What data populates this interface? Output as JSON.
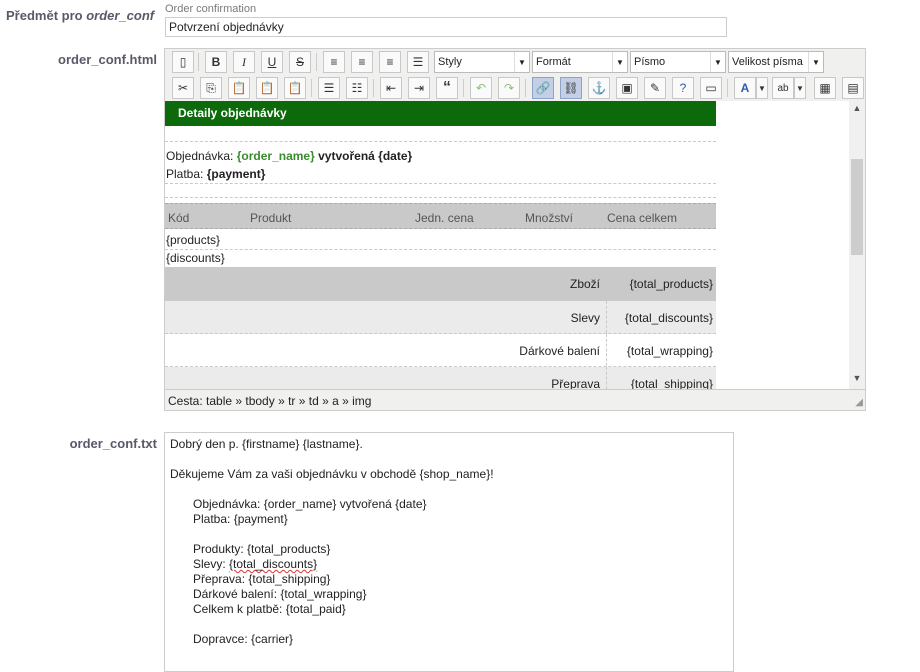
{
  "subject": {
    "label_prefix": "Předmět pro",
    "label_key": "order_conf",
    "hint": "Order confirmation",
    "value": "Potvrzení objednávky"
  },
  "html_field": {
    "label": "order_conf.html",
    "toolbar": {
      "styles": "Styly",
      "format": "Formát",
      "font": "Písmo",
      "size": "Velikost písma"
    },
    "content": {
      "header": "Detaily objednávky",
      "order_prefix": "Objednávka:",
      "order_name": "{order_name}",
      "created": "vytvořená {date}",
      "payment_prefix": "Platba:",
      "payment": "{payment}",
      "columns": [
        "Kód",
        "Produkt",
        "Jedn. cena",
        "Množství",
        "Cena celkem"
      ],
      "products": "{products}",
      "discounts": "{discounts}",
      "summary": [
        {
          "label": "Zboží",
          "value": "{total_products}"
        },
        {
          "label": "Slevy",
          "value": "{total_discounts}"
        },
        {
          "label": "Dárkové balení",
          "value": "{total_wrapping}"
        },
        {
          "label": "Přeprava",
          "value": "{total_shipping}"
        }
      ]
    },
    "path": "Cesta: table » tbody » tr » td » a » img"
  },
  "txt_field": {
    "label": "order_conf.txt",
    "lines": {
      "l1": "Dobrý den p. {firstname} {lastname}.",
      "l2": "Děkujeme Vám za vaši objednávku v obchodě {shop_name}!",
      "l3": "Objednávka: {order_name} vytvořená {date}",
      "l4": "Platba: {payment}",
      "l5": "Produkty: {total_products}",
      "l6_prefix": "Slevy: ",
      "l6_var": "{total_discounts}",
      "l7": "Přeprava: {total_shipping}",
      "l8": "Dárkové balení: {total_wrapping}",
      "l9": "Celkem k platbě: {total_paid}",
      "l10": "Dopravce: {carrier}"
    }
  }
}
